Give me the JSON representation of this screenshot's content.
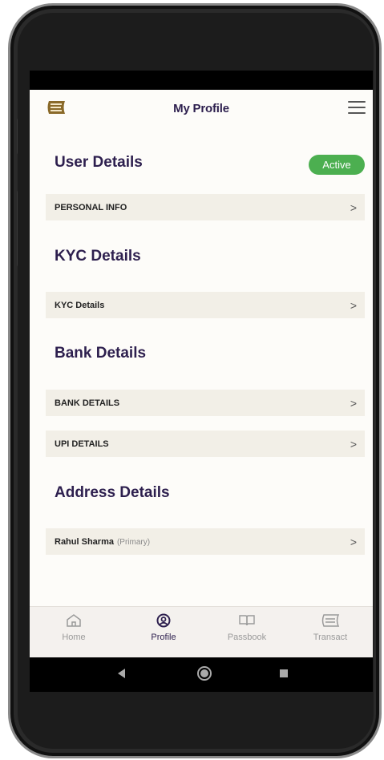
{
  "header": {
    "title": "My Profile",
    "logo_icon": "brand-logo",
    "menu_icon": "hamburger-menu-icon"
  },
  "user_details": {
    "title": "User Details",
    "status": "Active",
    "status_color": "#4caf50",
    "rows": [
      {
        "label": "PERSONAL INFO",
        "chevron": ">"
      }
    ]
  },
  "kyc_details": {
    "title": "KYC Details",
    "rows": [
      {
        "label": "KYC Details",
        "chevron": ">"
      }
    ]
  },
  "bank_details": {
    "title": "Bank Details",
    "rows": [
      {
        "label": "BANK DETAILS",
        "chevron": ">"
      },
      {
        "label": "UPI DETAILS",
        "chevron": ">"
      }
    ]
  },
  "address_details": {
    "title": "Address Details",
    "rows": [
      {
        "label": "Rahul Sharma",
        "tag": "(Primary)",
        "chevron": ">"
      }
    ]
  },
  "bottom_nav": {
    "active": "Profile",
    "items": [
      {
        "label": "Home",
        "icon": "home-icon"
      },
      {
        "label": "Profile",
        "icon": "profile-icon"
      },
      {
        "label": "Passbook",
        "icon": "book-icon"
      },
      {
        "label": "Transact",
        "icon": "transact-icon"
      }
    ]
  },
  "colors": {
    "brand_dark": "#2d1f4e",
    "brand_gold": "#8a6a2a",
    "row_bg": "#f2efe7"
  }
}
